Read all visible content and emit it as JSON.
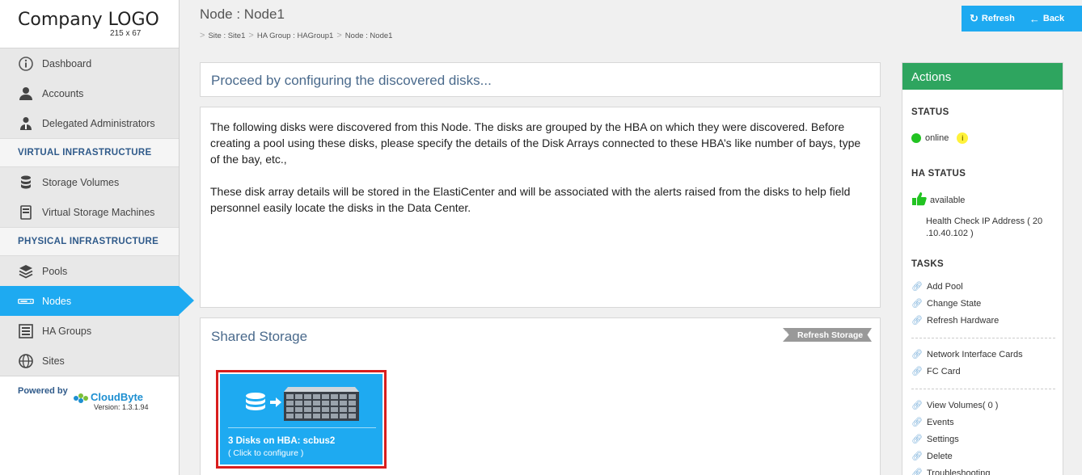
{
  "logo": {
    "title": "Company LOGO",
    "size": "215 x 67"
  },
  "sidebar": {
    "items_top": [
      {
        "label": "Dashboard",
        "icon": "info-circle-icon"
      },
      {
        "label": "Accounts",
        "icon": "user-icon"
      },
      {
        "label": "Delegated Administrators",
        "icon": "admin-user-icon"
      }
    ],
    "section_virtual": "VIRTUAL INFRASTRUCTURE",
    "items_virtual": [
      {
        "label": "Storage Volumes",
        "icon": "database-icon"
      },
      {
        "label": "Virtual Storage Machines",
        "icon": "vsm-icon"
      }
    ],
    "section_physical": "PHYSICAL INFRASTRUCTURE",
    "items_physical": [
      {
        "label": "Pools",
        "icon": "layers-icon"
      },
      {
        "label": "Nodes",
        "icon": "node-icon",
        "active": true
      },
      {
        "label": "HA Groups",
        "icon": "rack-icon"
      },
      {
        "label": "Sites",
        "icon": "globe-icon"
      }
    ],
    "powered_by": "Powered by",
    "brand": "CloudByte",
    "version": "Version: 1.3.1.94"
  },
  "header": {
    "title": "Node : Node1",
    "breadcrumb": [
      "Site : Site1",
      "HA Group : HAGroup1",
      "Node : Node1"
    ],
    "refresh_label": "Refresh",
    "back_label": "Back"
  },
  "main": {
    "proceed_title": "Proceed by configuring the discovered disks...",
    "description_1": "The following disks were discovered from this Node. The disks are grouped by the HBA on which they were discovered. Before creating a pool using these disks, please specify the details of the Disk Arrays connected to these HBA’s like number of bays, type of the bay, etc.,",
    "description_2": "These disk array details will be stored in the ElastiCenter and will be associated with the alerts raised from the disks to help field personnel easily locate the disks in the Data Center.",
    "shared_title": "Shared Storage",
    "refresh_storage_label": "Refresh Storage",
    "disk_card": {
      "title": "3 Disks on HBA: scbus2",
      "subtitle": "( Click to configure )"
    }
  },
  "actions": {
    "title": "Actions",
    "status_label": "STATUS",
    "status_value": "online",
    "ha_status_label": "HA STATUS",
    "ha_status_value": "available",
    "health_check": "Health Check IP Address ( 20 .10.40.102 )",
    "tasks_label": "TASKS",
    "links_group1": [
      "Add Pool",
      "Change State",
      "Refresh Hardware"
    ],
    "links_group2": [
      "Network Interface Cards",
      "FC Card"
    ],
    "links_group3": [
      "View Volumes( 0 )",
      "Events",
      "Settings",
      "Delete",
      "Troubleshooting"
    ]
  },
  "colors": {
    "accent": "#1eaaf1",
    "actions_header": "#2ea55f",
    "highlight_border": "#d81e1e",
    "online": "#22c322"
  }
}
